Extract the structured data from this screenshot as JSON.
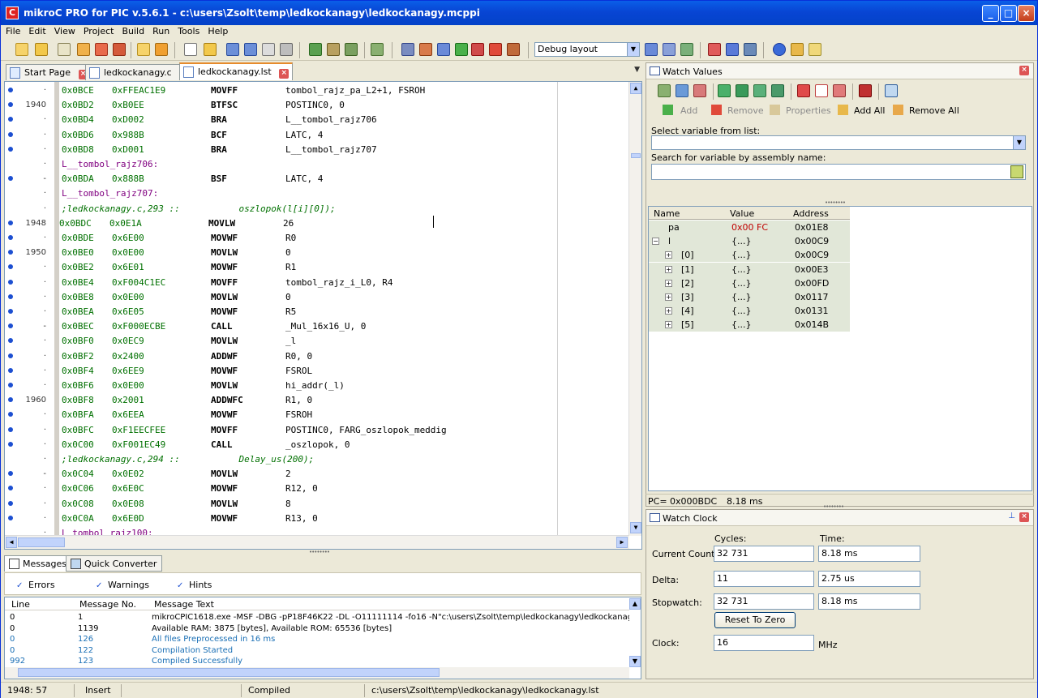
{
  "window": {
    "title": "mikroC PRO for PIC v.5.6.1 - c:\\users\\Zsolt\\temp\\ledkockanagy\\ledkockanagy.mcppi",
    "app_icon_letter": "C",
    "minimize": "_",
    "maximize": "□",
    "close": "×"
  },
  "menu": [
    "File",
    "Edit",
    "View",
    "Project",
    "Build",
    "Run",
    "Tools",
    "Help"
  ],
  "toolbar": {
    "layout_value": "Debug layout"
  },
  "editor_tabs": [
    {
      "label": "Start Page"
    },
    {
      "label": "ledkockanagy.c"
    },
    {
      "label": "ledkockanagy.lst"
    }
  ],
  "editor": {
    "lines": [
      {
        "gutter": "·",
        "dot": true,
        "kind": "ins",
        "addr": "0x0BCE",
        "hex": "0xFFEAC1E9",
        "op": "MOVFF",
        "arg": "tombol_rajz_pa_L2+1, FSROH"
      },
      {
        "gutter": "1940",
        "dot": true,
        "kind": "ins",
        "addr": "0x0BD2",
        "hex": "0xB0EE",
        "op": "BTFSC",
        "arg": "POSTINC0, 0"
      },
      {
        "gutter": "·",
        "dot": true,
        "kind": "ins",
        "addr": "0x0BD4",
        "hex": "0xD002",
        "op": "BRA",
        "arg": "L__tombol_rajz706"
      },
      {
        "gutter": "·",
        "dot": true,
        "kind": "ins",
        "addr": "0x0BD6",
        "hex": "0x988B",
        "op": "BCF",
        "arg": "LATC, 4"
      },
      {
        "gutter": "·",
        "dot": true,
        "kind": "ins",
        "addr": "0x0BD8",
        "hex": "0xD001",
        "op": "BRA",
        "arg": "L__tombol_rajz707"
      },
      {
        "gutter": "·",
        "dot": false,
        "kind": "label",
        "text": "L__tombol_rajz706:"
      },
      {
        "gutter": "-",
        "dot": true,
        "kind": "ins",
        "addr": "0x0BDA",
        "hex": "0x888B",
        "op": "BSF",
        "arg": "LATC, 4"
      },
      {
        "gutter": "·",
        "dot": false,
        "kind": "label",
        "text": "L__tombol_rajz707:"
      },
      {
        "gutter": "·",
        "dot": false,
        "kind": "comment",
        "text": ";ledkockanagy.c,293 ::           oszlopok(l[i][0]);"
      },
      {
        "gutter": "1948",
        "dot": true,
        "kind": "ins",
        "addr": "0x0BDC",
        "hex": "0x0E1A",
        "op": "MOVLW",
        "arg": "26",
        "highlight": true
      },
      {
        "gutter": "·",
        "dot": true,
        "kind": "ins",
        "addr": "0x0BDE",
        "hex": "0x6E00",
        "op": "MOVWF",
        "arg": "R0"
      },
      {
        "gutter": "1950",
        "dot": true,
        "kind": "ins",
        "addr": "0x0BE0",
        "hex": "0x0E00",
        "op": "MOVLW",
        "arg": "0"
      },
      {
        "gutter": "·",
        "dot": true,
        "kind": "ins",
        "addr": "0x0BE2",
        "hex": "0x6E01",
        "op": "MOVWF",
        "arg": "R1"
      },
      {
        "gutter": "·",
        "dot": true,
        "kind": "ins",
        "addr": "0x0BE4",
        "hex": "0xF004C1EC",
        "op": "MOVFF",
        "arg": "tombol_rajz_i_L0, R4"
      },
      {
        "gutter": "·",
        "dot": true,
        "kind": "ins",
        "addr": "0x0BE8",
        "hex": "0x0E00",
        "op": "MOVLW",
        "arg": "0"
      },
      {
        "gutter": "·",
        "dot": true,
        "kind": "ins",
        "addr": "0x0BEA",
        "hex": "0x6E05",
        "op": "MOVWF",
        "arg": "R5"
      },
      {
        "gutter": "-",
        "dot": true,
        "kind": "ins",
        "addr": "0x0BEC",
        "hex": "0xF000ECBE",
        "op": "CALL",
        "arg": "_Mul_16x16_U, 0"
      },
      {
        "gutter": "·",
        "dot": true,
        "kind": "ins",
        "addr": "0x0BF0",
        "hex": "0x0EC9",
        "op": "MOVLW",
        "arg": "_l"
      },
      {
        "gutter": "·",
        "dot": true,
        "kind": "ins",
        "addr": "0x0BF2",
        "hex": "0x2400",
        "op": "ADDWF",
        "arg": "R0, 0"
      },
      {
        "gutter": "·",
        "dot": true,
        "kind": "ins",
        "addr": "0x0BF4",
        "hex": "0x6EE9",
        "op": "MOVWF",
        "arg": "FSROL"
      },
      {
        "gutter": "·",
        "dot": true,
        "kind": "ins",
        "addr": "0x0BF6",
        "hex": "0x0E00",
        "op": "MOVLW",
        "arg": "hi_addr(_l)"
      },
      {
        "gutter": "1960",
        "dot": true,
        "kind": "ins",
        "addr": "0x0BF8",
        "hex": "0x2001",
        "op": "ADDWFC",
        "arg": "R1, 0"
      },
      {
        "gutter": "·",
        "dot": true,
        "kind": "ins",
        "addr": "0x0BFA",
        "hex": "0x6EEA",
        "op": "MOVWF",
        "arg": "FSROH"
      },
      {
        "gutter": "·",
        "dot": true,
        "kind": "ins",
        "addr": "0x0BFC",
        "hex": "0xF1EECFEE",
        "op": "MOVFF",
        "arg": "POSTINC0, FARG_oszlopok_meddig"
      },
      {
        "gutter": "·",
        "dot": true,
        "kind": "ins",
        "addr": "0x0C00",
        "hex": "0xF001EC49",
        "op": "CALL",
        "arg": "_oszlopok, 0"
      },
      {
        "gutter": "·",
        "dot": false,
        "kind": "comment",
        "text": ";ledkockanagy.c,294 ::           Delay_us(200);"
      },
      {
        "gutter": "-",
        "dot": true,
        "kind": "ins",
        "addr": "0x0C04",
        "hex": "0x0E02",
        "op": "MOVLW",
        "arg": "2"
      },
      {
        "gutter": "·",
        "dot": true,
        "kind": "ins",
        "addr": "0x0C06",
        "hex": "0x6E0C",
        "op": "MOVWF",
        "arg": "R12, 0"
      },
      {
        "gutter": "·",
        "dot": true,
        "kind": "ins",
        "addr": "0x0C08",
        "hex": "0x0E08",
        "op": "MOVLW",
        "arg": "8"
      },
      {
        "gutter": "·",
        "dot": true,
        "kind": "ins",
        "addr": "0x0C0A",
        "hex": "0x6E0D",
        "op": "MOVWF",
        "arg": "R13, 0"
      },
      {
        "gutter": "·",
        "dot": false,
        "kind": "label",
        "text": "L tombol rajz100:"
      }
    ]
  },
  "messages": {
    "tabs": [
      "Messages",
      "Quick Converter"
    ],
    "filters": [
      "Errors",
      "Warnings",
      "Hints"
    ],
    "columns": [
      "Line",
      "Message No.",
      "Message Text"
    ],
    "rows": [
      {
        "line": "0",
        "no": "1",
        "text": "mikroCPIC1618.exe -MSF -DBG -pP18F46K22 -DL -O11111114 -fo16 -N\"c:\\users\\Zsolt\\temp\\ledkockanagy\\ledkockanagy.mcppi\"",
        "blue": false
      },
      {
        "line": "0",
        "no": "1139",
        "text": "Available RAM: 3875 [bytes], Available ROM: 65536 [bytes]",
        "blue": false
      },
      {
        "line": "0",
        "no": "126",
        "text": "All files Preprocessed in 16 ms",
        "blue": true
      },
      {
        "line": "0",
        "no": "122",
        "text": "Compilation Started",
        "blue": true
      },
      {
        "line": "992",
        "no": "123",
        "text": "Compiled Successfully",
        "blue": true
      }
    ]
  },
  "status": {
    "position": "1948: 57",
    "mode": "Insert",
    "state": "Compiled",
    "file": "c:\\users\\Zsolt\\temp\\ledkockanagy\\ledkockanagy.lst"
  },
  "watch_values": {
    "title": "Watch Values",
    "actions": [
      "Add",
      "Remove",
      "Properties",
      "Add All",
      "Remove All"
    ],
    "select_label": "Select variable from list:",
    "search_label": "Search for variable by assembly name:",
    "columns": [
      "Name",
      "Value",
      "Address"
    ],
    "rows": [
      {
        "expander": "",
        "name": "pa",
        "value": "0x00 FC",
        "address": "0x01E8",
        "red": true,
        "indent": 0
      },
      {
        "expander": "−",
        "name": "l",
        "value": "{...}",
        "address": "0x00C9",
        "red": false,
        "indent": 0
      },
      {
        "expander": "+",
        "name": "[0]",
        "value": "{...}",
        "address": "0x00C9",
        "red": false,
        "indent": 1
      },
      {
        "expander": "+",
        "name": "[1]",
        "value": "{...}",
        "address": "0x00E3",
        "red": false,
        "indent": 1
      },
      {
        "expander": "+",
        "name": "[2]",
        "value": "{...}",
        "address": "0x00FD",
        "red": false,
        "indent": 1
      },
      {
        "expander": "+",
        "name": "[3]",
        "value": "{...}",
        "address": "0x0117",
        "red": false,
        "indent": 1
      },
      {
        "expander": "+",
        "name": "[4]",
        "value": "{...}",
        "address": "0x0131",
        "red": false,
        "indent": 1
      },
      {
        "expander": "+",
        "name": "[5]",
        "value": "{...}",
        "address": "0x014B",
        "red": false,
        "indent": 1
      }
    ],
    "pc": "PC= 0x000BDC",
    "pc_time": "8.18 ms"
  },
  "watch_clock": {
    "title": "Watch Clock",
    "cycles_header": "Cycles:",
    "time_header": "Time:",
    "current_label": "Current Count:",
    "current_cycles": "32 731",
    "current_time": "8.18 ms",
    "delta_label": "Delta:",
    "delta_cycles": "11",
    "delta_time": "2.75 us",
    "stopwatch_label": "Stopwatch:",
    "stopwatch_cycles": "32 731",
    "stopwatch_time": "8.18 ms",
    "reset_label": "Reset To Zero",
    "clock_label": "Clock:",
    "clock_value": "16",
    "clock_unit": "MHz"
  },
  "colors": {
    "title_bar": "#0845d4",
    "code_green": "#007000",
    "label_purple": "#800080",
    "accent_tab": "#e68b2c",
    "watch_row_bg": "#e1e7d8",
    "value_red": "#c00000"
  }
}
